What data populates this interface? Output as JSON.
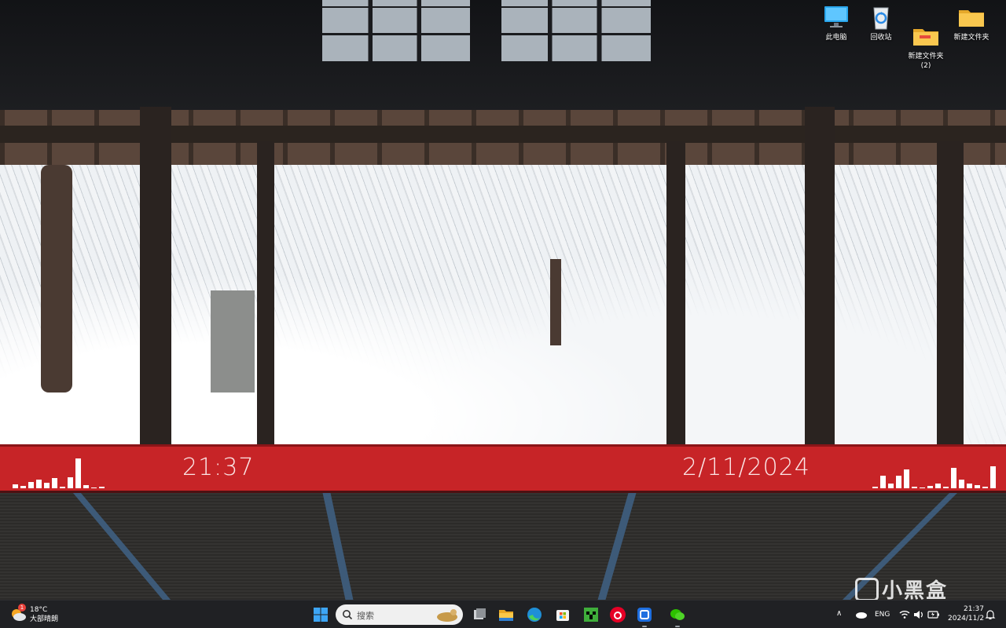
{
  "desktop": {
    "icons": [
      {
        "label": "此电脑",
        "icon": "computer-monitor-icon"
      },
      {
        "label": "回收站",
        "icon": "recycle-bin-icon"
      },
      {
        "label": "新建文件夹\n(2)",
        "icon": "folder-icon"
      },
      {
        "label": "新建文件夹",
        "icon": "folder-icon"
      }
    ]
  },
  "wallpaper_widget": {
    "time": "21:37",
    "date": "2/11/2024",
    "accent_color": "#c72427"
  },
  "taskbar": {
    "weather": {
      "temp": "18°C",
      "condition": "大部晴朗",
      "badge": "1"
    },
    "search_placeholder": "搜索",
    "apps": [
      "windows-start-icon",
      "task-view-icon",
      "file-explorer-icon",
      "edge-icon",
      "microsoft-store-icon",
      "minecraft-icon",
      "netease-music-icon",
      "app-icon",
      "wechat-icon"
    ],
    "tray": {
      "language": "ENG",
      "time": "21:37",
      "date": "2024/11/2"
    }
  },
  "watermark": {
    "text": "小黑盒"
  }
}
